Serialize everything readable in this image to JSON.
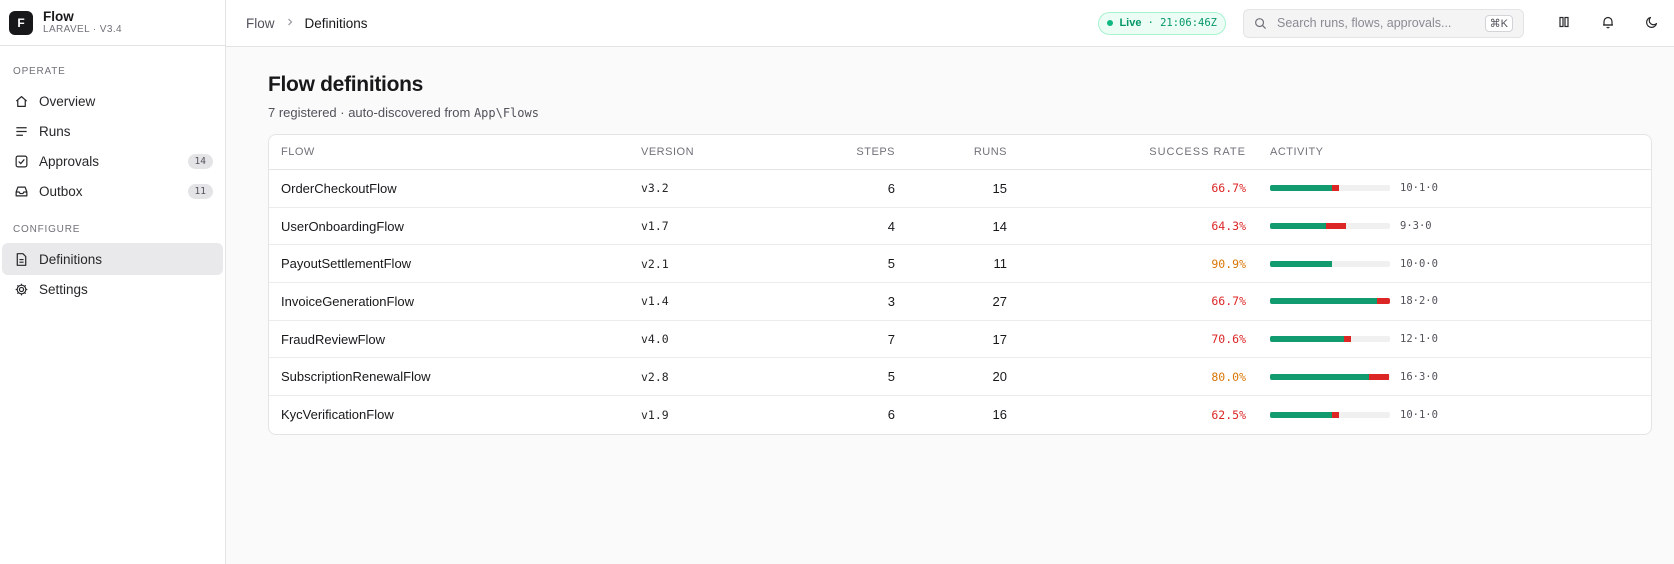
{
  "brand": {
    "logo_letter": "F",
    "name": "Flow",
    "subtitle": "LARAVEL · V3.4"
  },
  "sidebar": {
    "sections": [
      {
        "heading": "OPERATE",
        "items": [
          {
            "label": "Overview",
            "icon": "home-icon",
            "badge": ""
          },
          {
            "label": "Runs",
            "icon": "list-icon",
            "badge": ""
          },
          {
            "label": "Approvals",
            "icon": "check-square-icon",
            "badge": "14"
          },
          {
            "label": "Outbox",
            "icon": "inbox-icon",
            "badge": "11"
          }
        ]
      },
      {
        "heading": "CONFIGURE",
        "items": [
          {
            "label": "Definitions",
            "icon": "file-icon",
            "badge": "",
            "active": true
          },
          {
            "label": "Settings",
            "icon": "gear-icon",
            "badge": ""
          }
        ]
      }
    ]
  },
  "topbar": {
    "breadcrumb": {
      "root": "Flow",
      "current": "Definitions"
    },
    "live": {
      "label": "Live",
      "time": "· 21:06:46Z"
    },
    "search": {
      "placeholder": "Search runs, flows, approvals...",
      "shortcut": "⌘K"
    }
  },
  "page": {
    "title": "Flow definitions",
    "subtitle_prefix": "7 registered · auto-discovered from ",
    "subtitle_namespace": "App\\Flows"
  },
  "table": {
    "headers": {
      "flow": "FLOW",
      "version": "VERSION",
      "steps": "STEPS",
      "runs": "RUNS",
      "success_rate": "SUCCESS RATE",
      "activity": "ACTIVITY"
    },
    "rows": [
      {
        "flow": "OrderCheckoutFlow",
        "version": "v3.2",
        "steps": "6",
        "runs": "15",
        "rate": "66.7%",
        "rate_color": "#dc2626",
        "ok": 10,
        "fail": 1,
        "pending": 0,
        "activity": "10·1·0"
      },
      {
        "flow": "UserOnboardingFlow",
        "version": "v1.7",
        "steps": "4",
        "runs": "14",
        "rate": "64.3%",
        "rate_color": "#dc2626",
        "ok": 9,
        "fail": 3,
        "pending": 0,
        "activity": "9·3·0"
      },
      {
        "flow": "PayoutSettlementFlow",
        "version": "v2.1",
        "steps": "5",
        "runs": "11",
        "rate": "90.9%",
        "rate_color": "#d97706",
        "ok": 10,
        "fail": 0,
        "pending": 0,
        "activity": "10·0·0"
      },
      {
        "flow": "InvoiceGenerationFlow",
        "version": "v1.4",
        "steps": "3",
        "runs": "27",
        "rate": "66.7%",
        "rate_color": "#dc2626",
        "ok": 18,
        "fail": 2,
        "pending": 0,
        "activity": "18·2·0"
      },
      {
        "flow": "FraudReviewFlow",
        "version": "v4.0",
        "steps": "7",
        "runs": "17",
        "rate": "70.6%",
        "rate_color": "#dc2626",
        "ok": 12,
        "fail": 1,
        "pending": 0,
        "activity": "12·1·0"
      },
      {
        "flow": "SubscriptionRenewalFlow",
        "version": "v2.8",
        "steps": "5",
        "runs": "20",
        "rate": "80.0%",
        "rate_color": "#d97706",
        "ok": 16,
        "fail": 3,
        "pending": 0,
        "activity": "16·3·0"
      },
      {
        "flow": "KycVerificationFlow",
        "version": "v1.9",
        "steps": "6",
        "runs": "16",
        "rate": "62.5%",
        "rate_color": "#dc2626",
        "ok": 10,
        "fail": 1,
        "pending": 0,
        "activity": "10·1·0"
      }
    ]
  },
  "colors": {
    "success": "#129b6e",
    "failure": "#dc2626",
    "warning": "#d97706",
    "live": "#059669"
  }
}
